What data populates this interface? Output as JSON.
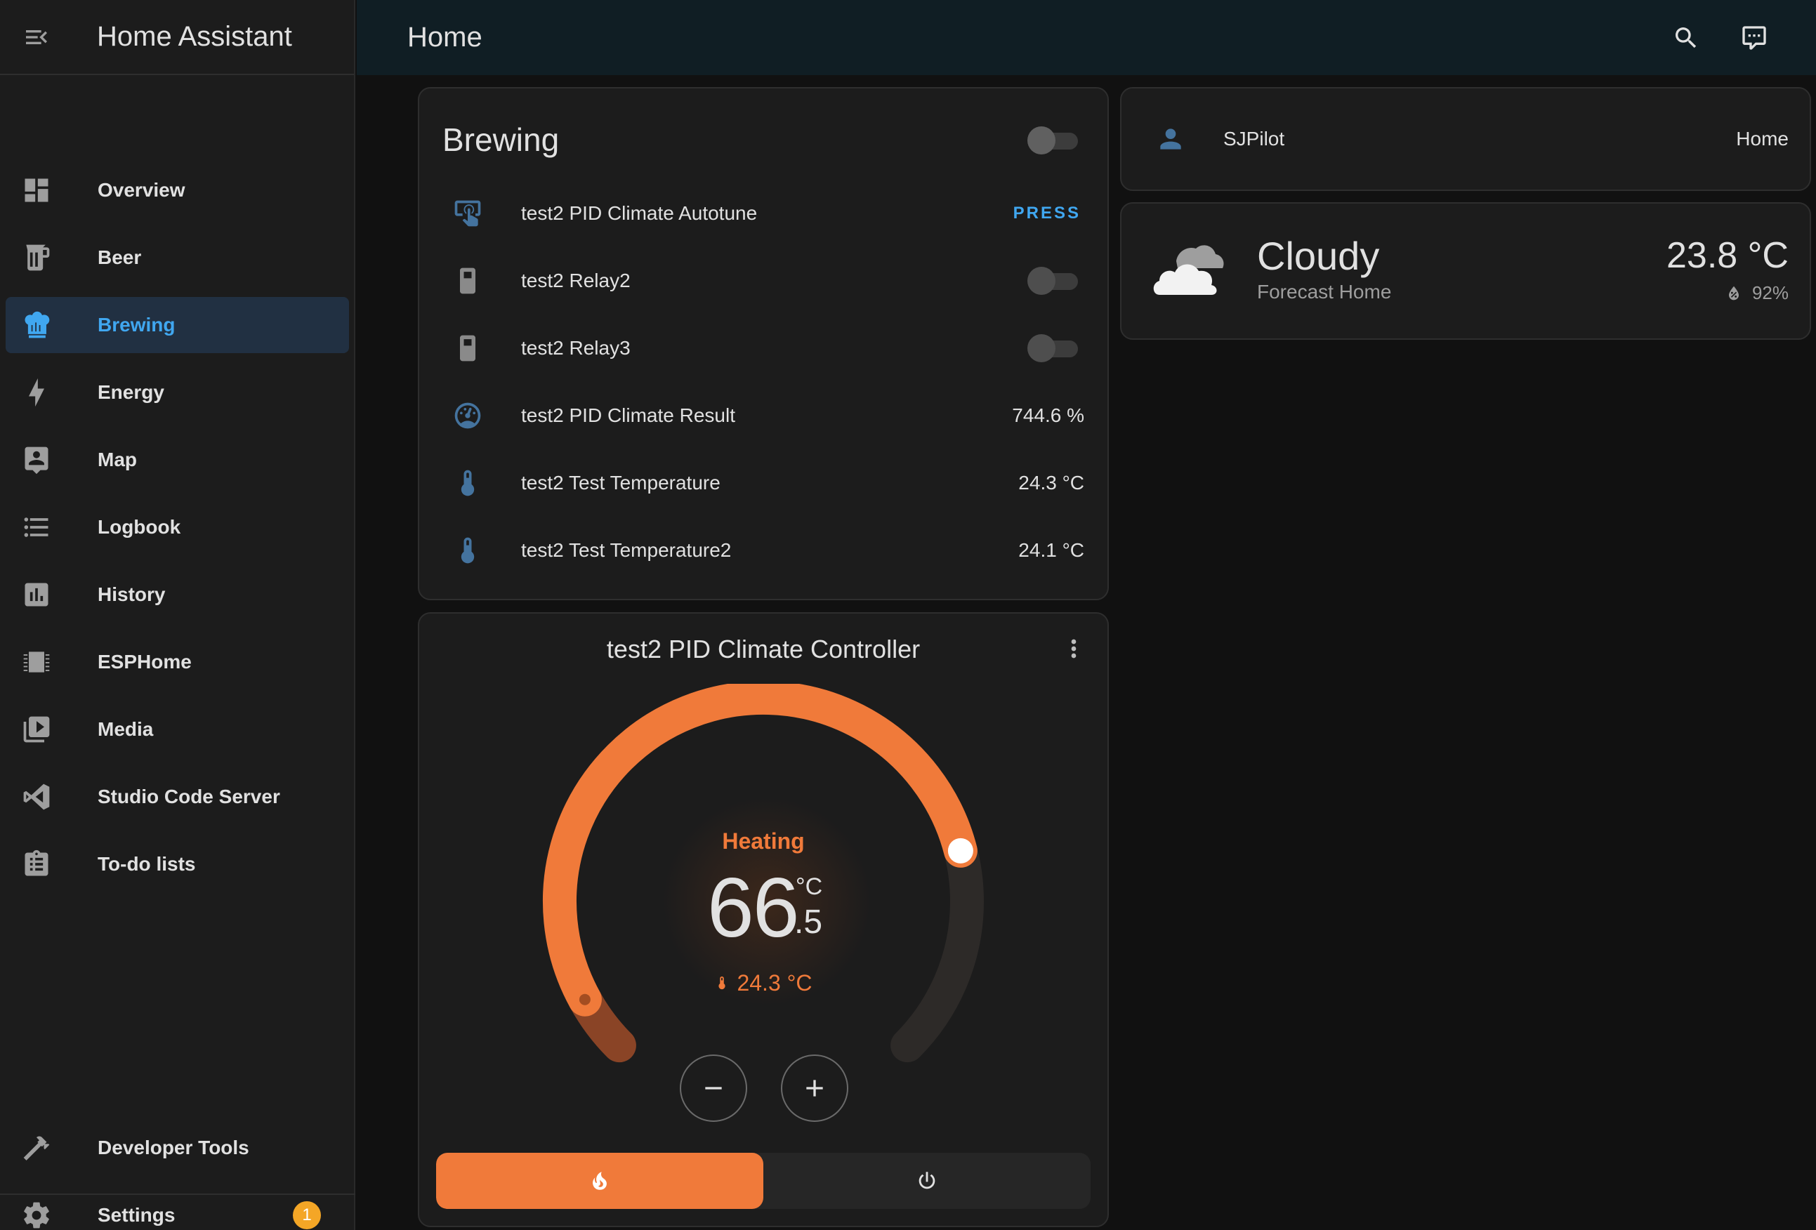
{
  "app": {
    "title": "Home Assistant"
  },
  "page": {
    "title": "Home"
  },
  "sidebar": {
    "items": [
      {
        "label": "Overview",
        "icon": "view-dashboard-icon"
      },
      {
        "label": "Beer",
        "icon": "beer-mug-icon"
      },
      {
        "label": "Brewing",
        "icon": "chef-hat-icon",
        "active": true
      },
      {
        "label": "Energy",
        "icon": "lightning-bolt-icon"
      },
      {
        "label": "Map",
        "icon": "account-box-icon"
      },
      {
        "label": "Logbook",
        "icon": "format-list-bulleted-icon"
      },
      {
        "label": "History",
        "icon": "chart-box-icon"
      },
      {
        "label": "ESPHome",
        "icon": "chip-icon"
      },
      {
        "label": "Media",
        "icon": "play-box-multiple-icon"
      },
      {
        "label": "Studio Code Server",
        "icon": "vscode-icon"
      }
    ],
    "todo": {
      "label": "To-do lists",
      "icon": "clipboard-list-icon"
    },
    "developer_tools": {
      "label": "Developer Tools",
      "icon": "hammer-icon"
    },
    "settings": {
      "label": "Settings",
      "icon": "cog-icon",
      "badge": "1"
    }
  },
  "brewing_card": {
    "title": "Brewing",
    "toggle_on": false,
    "rows": [
      {
        "name": "test2 PID Climate Autotune",
        "icon": "gesture-tap-button-icon",
        "action": "PRESS"
      },
      {
        "name": "test2 Relay2",
        "icon": "relay-switch-icon",
        "toggle_on": false
      },
      {
        "name": "test2 Relay3",
        "icon": "relay-switch-icon",
        "toggle_on": false
      },
      {
        "name": "test2 PID Climate Result",
        "icon": "gauge-icon",
        "value": "744.6 %"
      },
      {
        "name": "test2 Test Temperature",
        "icon": "thermometer-icon",
        "value": "24.3 °C"
      },
      {
        "name": "test2 Test Temperature2",
        "icon": "thermometer-icon",
        "value": "24.1 °C"
      }
    ]
  },
  "climate_card": {
    "title": "test2 PID Climate Controller",
    "hvac_action": "Heating",
    "target_integer": "66",
    "target_decimal": ".5",
    "unit": "°C",
    "current_temperature": "24.3 °C",
    "target_fraction": 0.78,
    "current_fraction": 0.06,
    "modes": [
      {
        "name": "heat",
        "icon": "fire-icon",
        "active": true
      },
      {
        "name": "off",
        "icon": "power-icon",
        "active": false
      }
    ],
    "colors": {
      "heat": "#f07a3a",
      "track": "#2d2a28"
    }
  },
  "person_card": {
    "name": "SJPilot",
    "state": "Home",
    "icon": "account-icon"
  },
  "weather_card": {
    "condition": "Cloudy",
    "name": "Forecast Home",
    "temperature": "23.8 °C",
    "humidity": "92%",
    "icon": "cloudy-icon"
  },
  "colors": {
    "accent": "#40a7f0",
    "sidebar_bg": "#1c1c1c",
    "topbar_bg": "#101e24",
    "badge": "#f4a626",
    "entity_icon": "#44739e"
  }
}
